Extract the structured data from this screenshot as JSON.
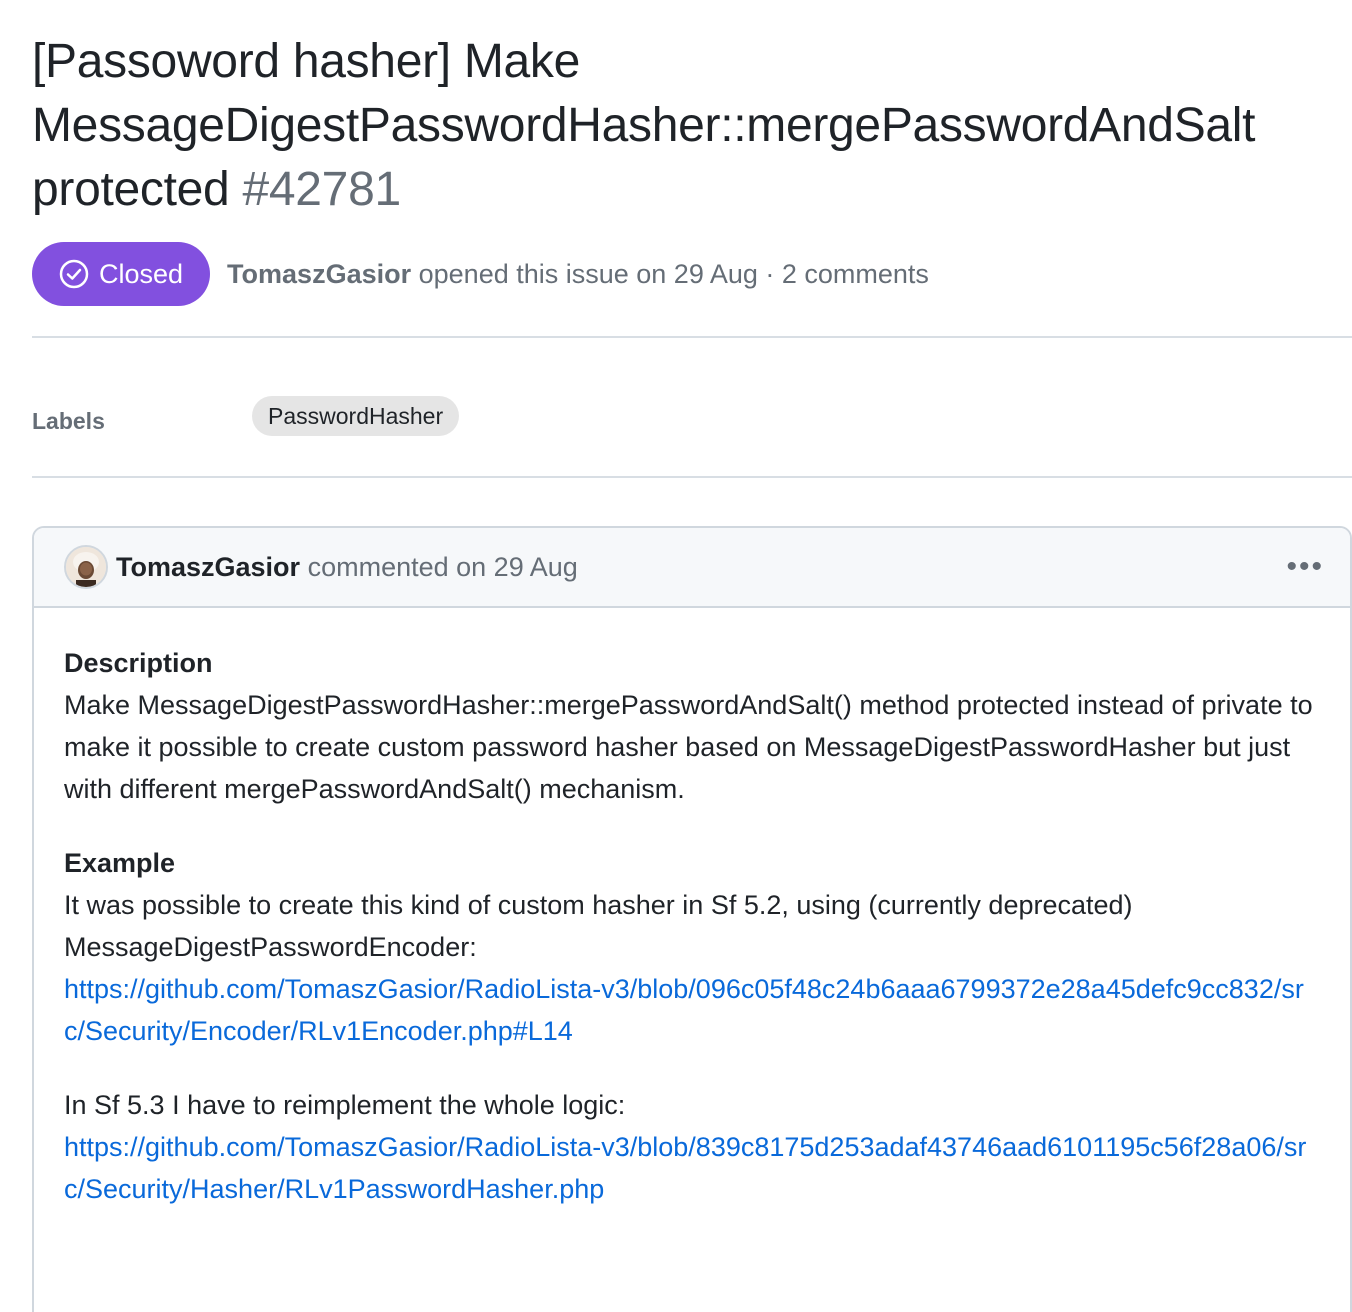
{
  "issue": {
    "title": "[Passoword hasher] Make MessageDigestPasswordHasher::mergePasswordAndSalt protected",
    "number": "#42781",
    "state": "Closed",
    "state_color": "#8250df",
    "author": "TomaszGasior",
    "opened_text": "opened this issue on 29 Aug · 2 comments"
  },
  "labels": {
    "heading": "Labels",
    "items": [
      "PasswordHasher"
    ]
  },
  "comment": {
    "author": "TomaszGasior",
    "meta": "commented on 29 Aug",
    "menu_icon": "kebab-horizontal-icon",
    "description_title": "Description",
    "description_text": "Make MessageDigestPasswordHasher::mergePasswordAndSalt() method protected instead of private to make it possible to create custom password hasher based on MessageDigestPasswordHasher but just with different mergePasswordAndSalt() mechanism.",
    "example_title": "Example",
    "example_text": "It was possible to create this kind of custom hasher in Sf 5.2, using (currently deprecated) MessageDigestPasswordEncoder:",
    "example_link": "https://github.com/TomaszGasior/RadioLista-v3/blob/096c05f48c24b6aaa6799372e28a45defc9cc832/src/Security/Encoder/RLv1Encoder.php#L14",
    "reimplement_text": "In Sf 5.3 I have to reimplement the whole logic:",
    "reimplement_link": "https://github.com/TomaszGasior/RadioLista-v3/blob/839c8175d253adaf43746aad6101195c56f28a06/src/Security/Hasher/RLv1PasswordHasher.php"
  },
  "colors": {
    "link": "#0969da",
    "muted": "#656d76",
    "border": "#d0d7de"
  }
}
